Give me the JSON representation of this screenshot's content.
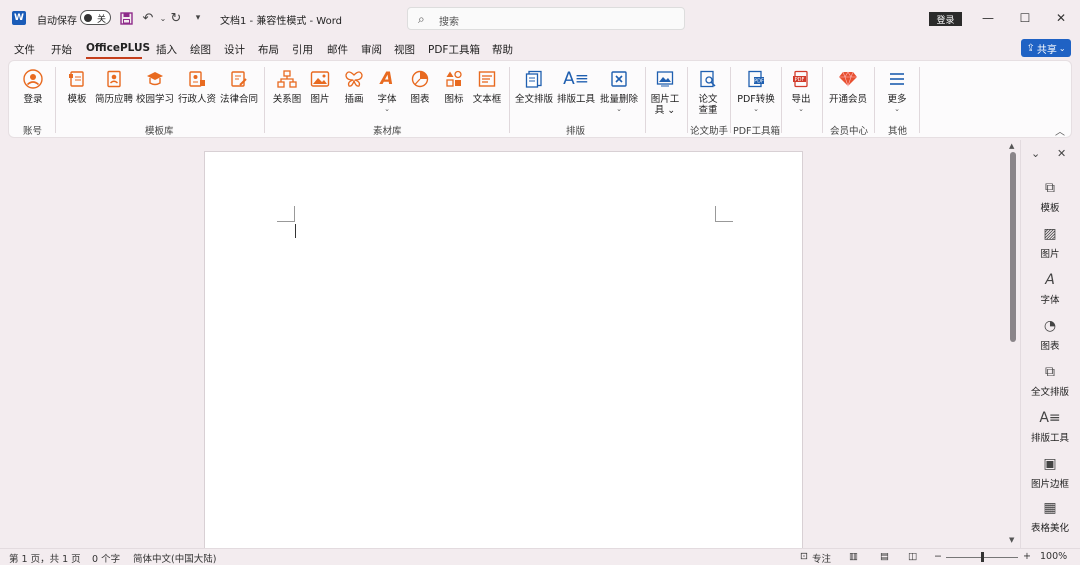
{
  "titlebar": {
    "logo": "W",
    "autosave_label": "自动保存",
    "autosave_state": "关",
    "doc_title": "文档1 - 兼容性模式 - Word",
    "search_placeholder": "搜索",
    "login": "登录",
    "icons": [
      "save-icon",
      "undo-icon",
      "redo-icon",
      "customize-chevron-icon"
    ]
  },
  "menu": {
    "tabs": [
      "文件",
      "开始",
      "OfficePLUS",
      "插入",
      "绘图",
      "设计",
      "布局",
      "引用",
      "邮件",
      "审阅",
      "视图",
      "PDF工具箱",
      "帮助"
    ],
    "active": "OfficePLUS",
    "share": "共享"
  },
  "ribbon": {
    "login": "登录",
    "templates": "模板",
    "resume": "简历应聘",
    "campus": "校园学习",
    "admin": "行政人资",
    "contract": "法律合同",
    "relation": "关系图",
    "picture": "图片",
    "illustration": "插画",
    "font": "字体",
    "chart": "图表",
    "icon": "图标",
    "textbox": "文本框",
    "full_layout": "全文排版",
    "layout_tool": "排版工具",
    "batch_delete": "批量删除",
    "pic_tool_1": "图片工",
    "pic_tool_2": "具",
    "paper_1": "论文",
    "paper_2": "查重",
    "pdf_convert": "PDF转换",
    "export": "导出",
    "vip": "开通会员",
    "more": "更多",
    "groups": {
      "account": "账号",
      "template_lib": "模板库",
      "material_lib": "素材库",
      "layout": "排版",
      "paper_helper": "论文助手",
      "pdf_tools": "PDF工具箱",
      "member": "会员中心",
      "other": "其他"
    }
  },
  "sidepanel": {
    "items": [
      "模板",
      "图片",
      "字体",
      "图表",
      "全文排版",
      "排版工具",
      "图片边框",
      "表格美化"
    ]
  },
  "status": {
    "page": "第 1 页，共 1 页",
    "words": "0 个字",
    "lang": "简体中文(中国大陆)",
    "focus": "专注",
    "zoom_minus": "−",
    "zoom_plus": "+",
    "zoom": "100%"
  },
  "colors": {
    "accent": "#e86a20",
    "share": "#1f62c4",
    "tab_underline": "#c43e1c"
  }
}
